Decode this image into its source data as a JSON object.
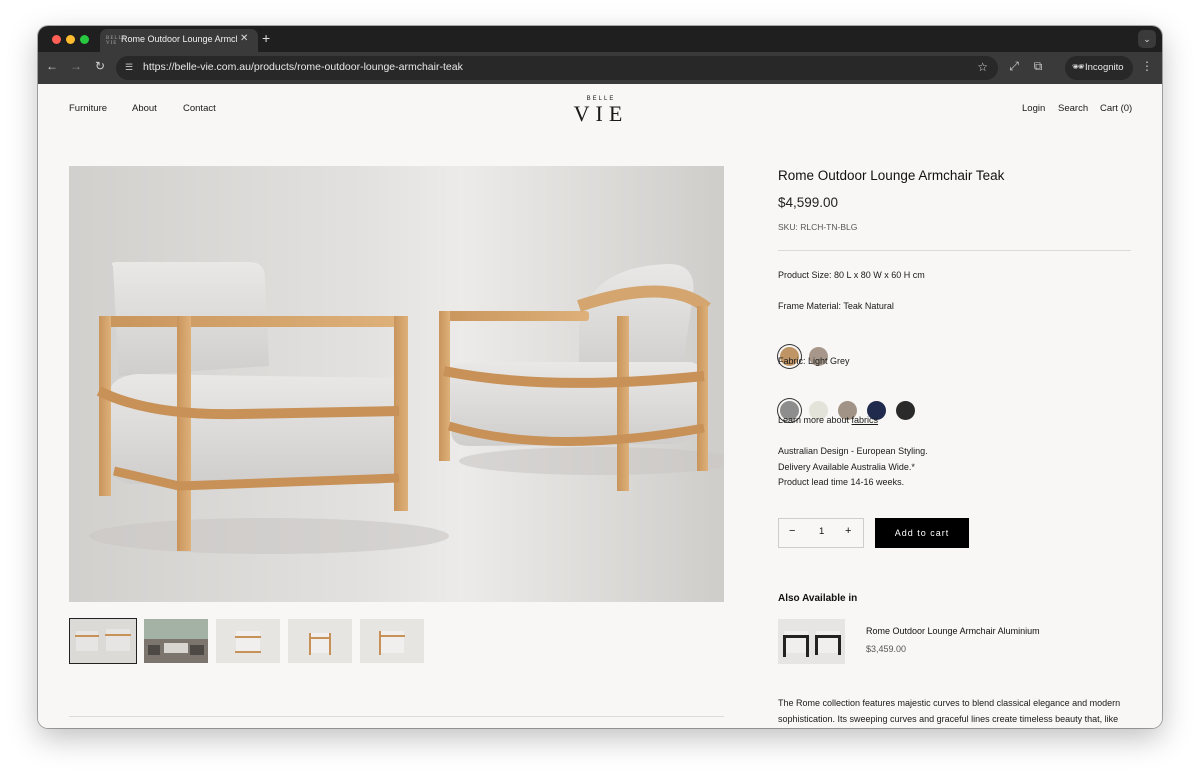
{
  "browser": {
    "tab_title": "Rome Outdoor Lounge Armchair Teak",
    "tab_favicon_text": "BELLE VIE",
    "url": "https://belle-vie.com.au/products/rome-outdoor-lounge-armchair-teak",
    "incognito_label": "Incognito",
    "icons": [
      "back-icon",
      "forward-icon",
      "reload-icon",
      "site-info-icon",
      "bookmark-star-icon",
      "fullscreen-icon",
      "extensions-icon",
      "incognito-icon",
      "menu-icon",
      "new-tab-icon",
      "close-tab-icon",
      "tab-dropdown-icon"
    ]
  },
  "site": {
    "nav_left": [
      "Furniture",
      "About",
      "Contact"
    ],
    "logo_top": "BELLE",
    "logo_bottom": "VIE",
    "nav_right": {
      "login": "Login",
      "search": "Search",
      "cart": "Cart (0)"
    }
  },
  "product": {
    "title": "Rome Outdoor Lounge Armchair Teak",
    "price": "$4,599.00",
    "sku": "SKU: RLCH-TN-BLG",
    "size": "Product Size: 80 L x 80 W x 60 H cm",
    "frame_label": "Frame Material:",
    "frame_value": "Teak Natural",
    "frame_swatches": [
      "#c09566",
      "#a6978a"
    ],
    "fabric_label": "Fabric:",
    "fabric_value": "Light Grey",
    "fabric_swatches": [
      "#8d8d8d",
      "#e3e3d9",
      "#a19486",
      "#1f2a4d",
      "#2a2a2a"
    ],
    "learn_more_prefix": "Learn more about ",
    "learn_more_link": "fabrics",
    "info_lines": [
      "Australian Design - European Styling.",
      "Delivery Available Australia Wide.*",
      "Product lead time 14-16 weeks."
    ],
    "quantity": "1",
    "minus": "−",
    "plus": "+",
    "add_to_cart": "Add to cart",
    "also_heading": "Also Available in",
    "also_name": "Rome Outdoor Lounge Armchair Aluminium",
    "also_price": "$3,459.00",
    "description": "The Rome collection features majestic curves to blend classical elegance and modern sophistication. Its sweeping curves and graceful lines create timeless beauty that, like"
  }
}
